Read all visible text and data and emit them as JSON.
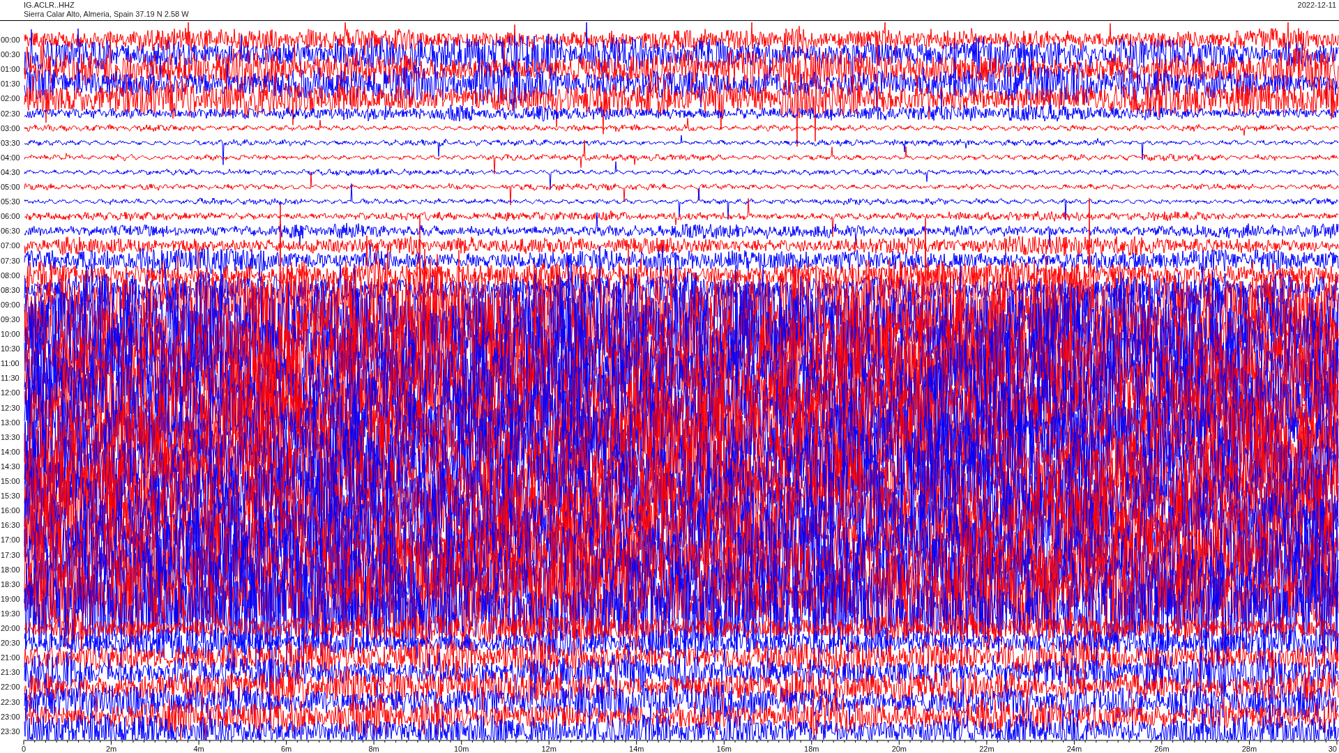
{
  "header": {
    "station": "IG.ACLR..HHZ",
    "location": "Sierra Calar Alto, Almeria, Spain  37.19 N 2.58 W",
    "date": "2022-12-11"
  },
  "hour_labels": [
    "00:00",
    "00:30",
    "01:00",
    "01:30",
    "02:00",
    "02:30",
    "03:00",
    "03:30",
    "04:00",
    "04:30",
    "05:00",
    "05:30",
    "06:00",
    "06:30",
    "07:00",
    "07:30",
    "08:00",
    "08:30",
    "09:00",
    "09:30",
    "10:00",
    "10:30",
    "11:00",
    "11:30",
    "12:00",
    "12:30",
    "13:00",
    "13:30",
    "14:00",
    "14:30",
    "15:00",
    "15:30",
    "16:00",
    "16:30",
    "17:00",
    "17:30",
    "18:00",
    "18:30",
    "19:00",
    "19:30",
    "20:00",
    "20:30",
    "21:00",
    "21:30",
    "22:00",
    "22:30",
    "23:00",
    "23:30"
  ],
  "time_axis": [
    "0",
    "2m",
    "4m",
    "6m",
    "8m",
    "10m",
    "12m",
    "14m",
    "16m",
    "18m",
    "20m",
    "22m",
    "24m",
    "26m",
    "28m",
    "30"
  ]
}
